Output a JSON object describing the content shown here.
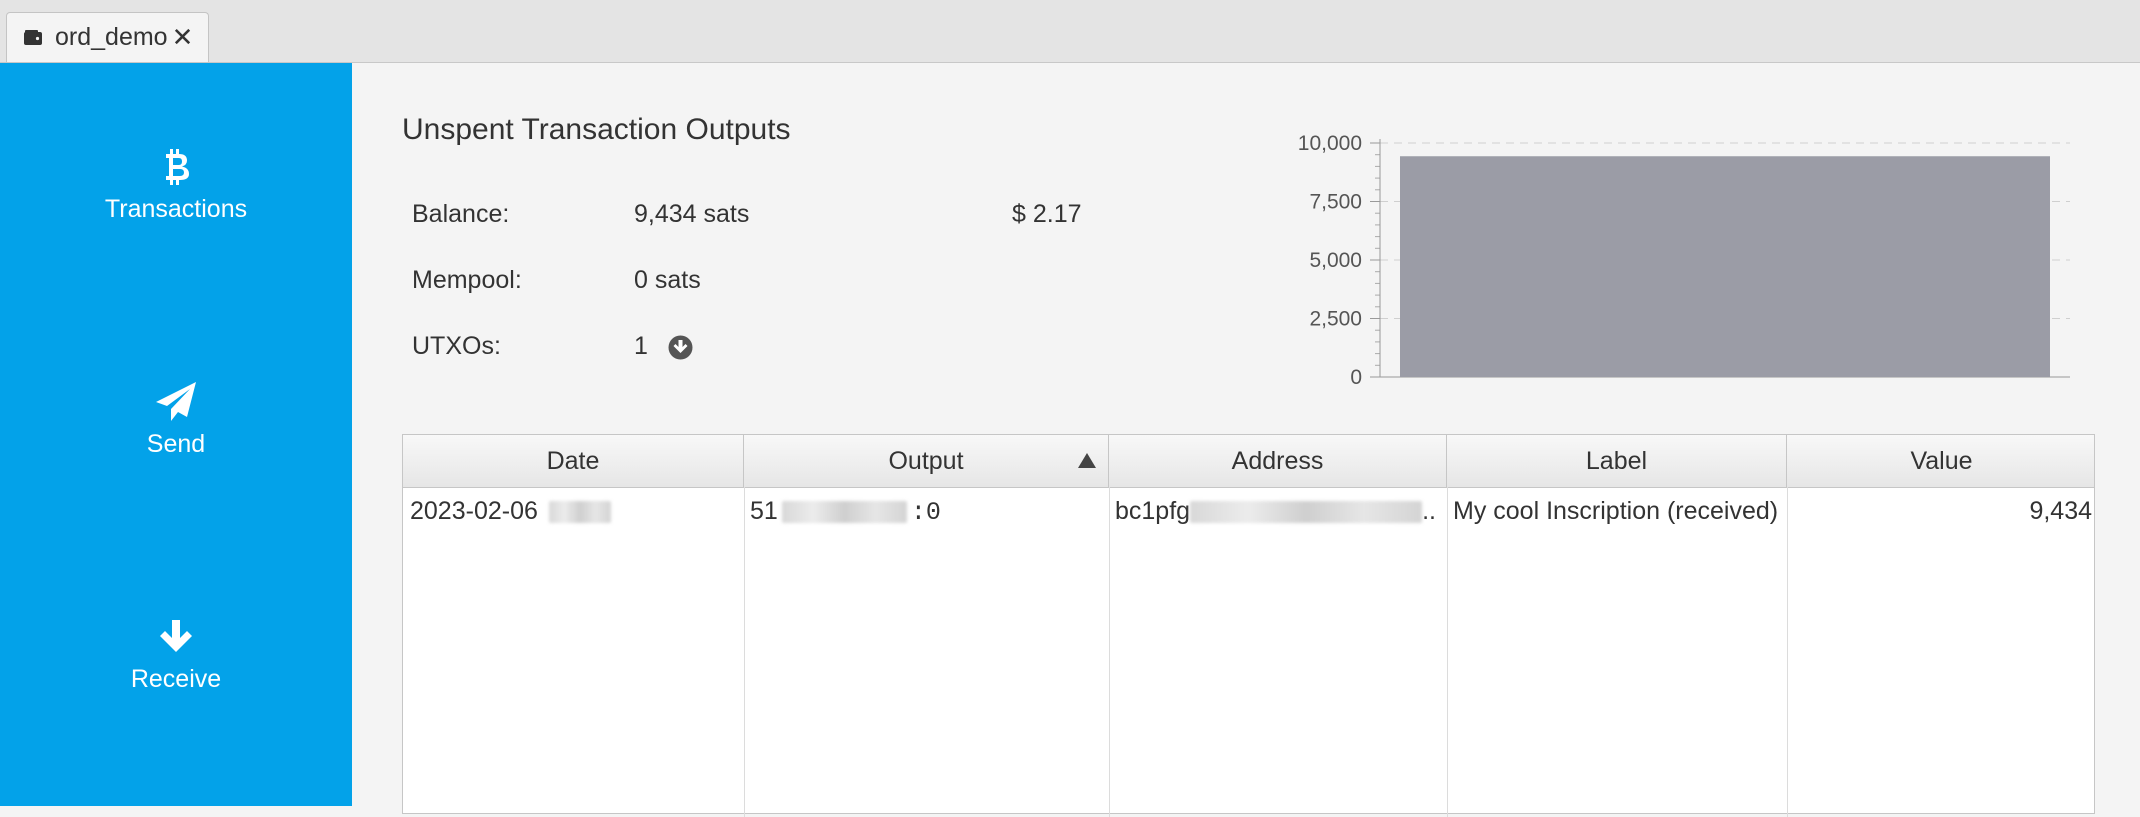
{
  "tab": {
    "title": "ord_demo",
    "close": "✕",
    "icon": "wallet-icon"
  },
  "sidebar": {
    "items": [
      {
        "label": "Transactions",
        "icon": "bitcoin-icon"
      },
      {
        "label": "Send",
        "icon": "paper-plane-icon"
      },
      {
        "label": "Receive",
        "icon": "arrow-down-icon"
      }
    ],
    "color": "#03a2e9"
  },
  "utxos": {
    "title": "Unspent Transaction Outputs",
    "balance_label": "Balance:",
    "balance_value": "9,434 sats",
    "balance_fiat": "$ 2.17",
    "mempool_label": "Mempool:",
    "mempool_value": "0 sats",
    "utxo_label": "UTXOs:",
    "utxo_value": "1"
  },
  "chart_data": {
    "type": "bar",
    "categories": [
      ""
    ],
    "values": [
      9434
    ],
    "title": "",
    "xlabel": "",
    "ylabel": "",
    "ylim": [
      0,
      10000
    ],
    "yticks": [
      "0",
      "2,500",
      "5,000",
      "7,500",
      "10,000"
    ],
    "grid": true,
    "bar_color": "#9b9ca6"
  },
  "table": {
    "columns": [
      "Date",
      "Output",
      "Address",
      "Label",
      "Value"
    ],
    "sorted_column": "Output",
    "rows": [
      {
        "date": "2023-02-06",
        "output_prefix": "51",
        "output_suffix": ":0",
        "address_prefix": "bc1pfg",
        "address_suffix": "..",
        "label": "My cool Inscription (received)",
        "value": "9,434"
      }
    ]
  }
}
